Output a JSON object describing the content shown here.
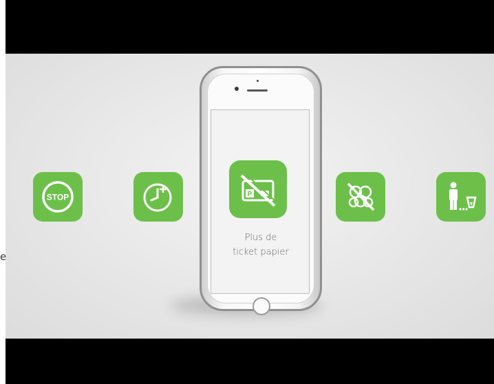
{
  "video": {
    "screen_caption_line1": "Plus de",
    "screen_caption_line2": "ticket papier",
    "stop_sign_text": "STOP",
    "edge_letter": "e"
  },
  "icons": [
    "stop-sign-icon",
    "clock-add-time-icon",
    "no-paper-ticket-icon",
    "no-coins-icon",
    "person-trash-bin-icon"
  ],
  "colors": {
    "accent_green": "#6cc04a",
    "background": "#e9e9e9",
    "letterbox": "#000000"
  }
}
